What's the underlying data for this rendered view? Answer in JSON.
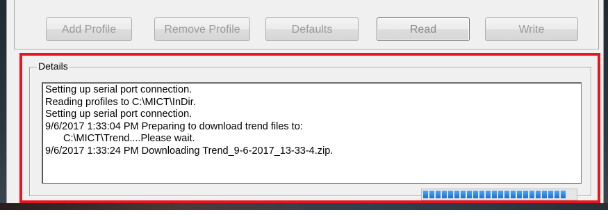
{
  "toolbar": {
    "buttons": [
      {
        "label": "Add Profile"
      },
      {
        "label": "Remove Profile"
      },
      {
        "label": "Defaults"
      },
      {
        "label": "Read"
      },
      {
        "label": "Write"
      }
    ]
  },
  "details": {
    "title": "Details",
    "log": [
      "Setting up serial port connection.",
      "Reading profiles to C:\\MICT\\InDir.",
      "Setting up serial port connection.",
      "9/6/2017 1:33:04 PM Preparing to download trend files to:",
      "C:\\MICT\\Trend....Please wait.",
      "9/6/2017 1:33:24 PM Downloading Trend_9-6-2017_13-33-4.zip."
    ]
  },
  "progress": {
    "fraction": 0.96,
    "color": "#1a6fd1"
  },
  "highlight_color": "#e8141f"
}
